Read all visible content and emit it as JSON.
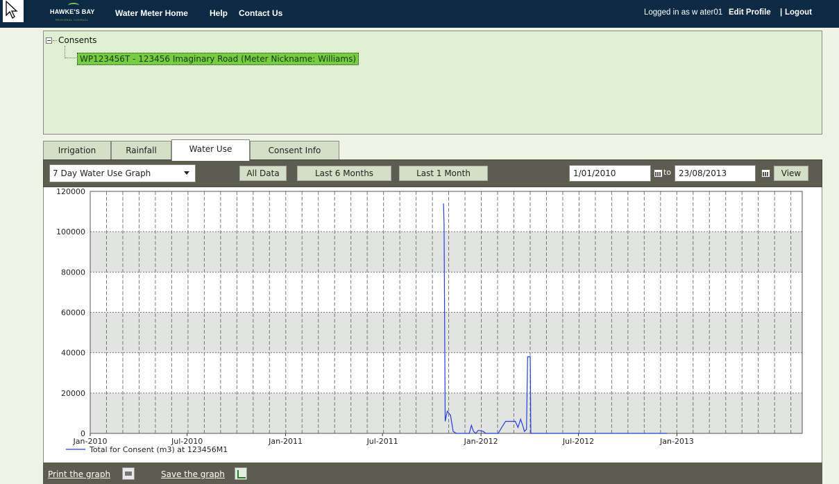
{
  "nav": {
    "logo_text": "HAWKE'S BAY",
    "logo_sub": "REGIONAL COUNCIL",
    "home": "Water Meter Home",
    "help": "Help",
    "contact": "Contact Us",
    "logged_in": "Logged in as w ater01",
    "edit_profile": "Edit Profile",
    "separator": "|",
    "logout": "Logout"
  },
  "consents": {
    "root_label": "Consents",
    "item": "WP123456T - 123456 Imaginary Road (Meter Nickname: Williams)"
  },
  "tabs": [
    {
      "label": "Irrigation"
    },
    {
      "label": "Rainfall"
    },
    {
      "label": "Water Use"
    },
    {
      "label": "Consent Info"
    }
  ],
  "active_tab": "Water Use",
  "toolbar": {
    "graph_type": "7 Day Water Use Graph",
    "all_data": "All Data",
    "last6": "Last 6 Months",
    "last1": "Last 1 Month",
    "from_date": "1/01/2010",
    "to_label": "to",
    "to_date": "23/08/2013",
    "view": "View"
  },
  "bottom": {
    "print": "Print the graph",
    "save": "Save the graph"
  },
  "colors": {
    "header": "#0d2a44",
    "panel_green": "#dff0d0",
    "tab_green": "#d3dfc6",
    "toolbar": "#5e5c4e",
    "series": "#1f3fe0",
    "band": "#e1e4e0"
  },
  "chart_data": {
    "type": "line",
    "title": "",
    "xlabel": "",
    "ylabel": "",
    "ylim": [
      0,
      120000
    ],
    "yticks": [
      0,
      20000,
      40000,
      60000,
      80000,
      100000,
      120000
    ],
    "xlim": [
      "2010-01-01",
      "2013-08-23"
    ],
    "xticks": [
      {
        "date": "2010-01-01",
        "label": "Jan-2010"
      },
      {
        "date": "2010-07-01",
        "label": "Jul-2010"
      },
      {
        "date": "2011-01-01",
        "label": "Jan-2011"
      },
      {
        "date": "2011-07-01",
        "label": "Jul-2011"
      },
      {
        "date": "2012-01-01",
        "label": "Jan-2012"
      },
      {
        "date": "2012-07-01",
        "label": "Jul-2012"
      },
      {
        "date": "2013-01-01",
        "label": "Jan-2013"
      }
    ],
    "grid": true,
    "legend_position": "bottom-left",
    "series": [
      {
        "name": "Total for Consent (m3) at 123456M1",
        "color": "#1f3fe0",
        "points": [
          [
            "2011-10-23",
            114000
          ],
          [
            "2011-10-24",
            104000
          ],
          [
            "2011-10-26",
            6000
          ],
          [
            "2011-10-30",
            11000
          ],
          [
            "2011-11-05",
            9000
          ],
          [
            "2011-11-10",
            1000
          ],
          [
            "2011-11-16",
            0
          ],
          [
            "2011-12-10",
            0
          ],
          [
            "2011-12-14",
            4000
          ],
          [
            "2011-12-18",
            1000
          ],
          [
            "2011-12-22",
            0
          ],
          [
            "2011-12-27",
            1500
          ],
          [
            "2012-01-05",
            1000
          ],
          [
            "2012-01-10",
            0
          ],
          [
            "2012-02-02",
            0
          ],
          [
            "2012-02-10",
            3500
          ],
          [
            "2012-02-16",
            6000
          ],
          [
            "2012-03-05",
            6000
          ],
          [
            "2012-03-10",
            3000
          ],
          [
            "2012-03-15",
            7000
          ],
          [
            "2012-03-20",
            3000
          ],
          [
            "2012-03-22",
            1000
          ],
          [
            "2012-03-26",
            2000
          ],
          [
            "2012-03-28",
            38000
          ],
          [
            "2012-04-02",
            38000
          ],
          [
            "2012-04-03",
            0
          ],
          [
            "2012-12-14",
            0
          ]
        ]
      }
    ]
  }
}
